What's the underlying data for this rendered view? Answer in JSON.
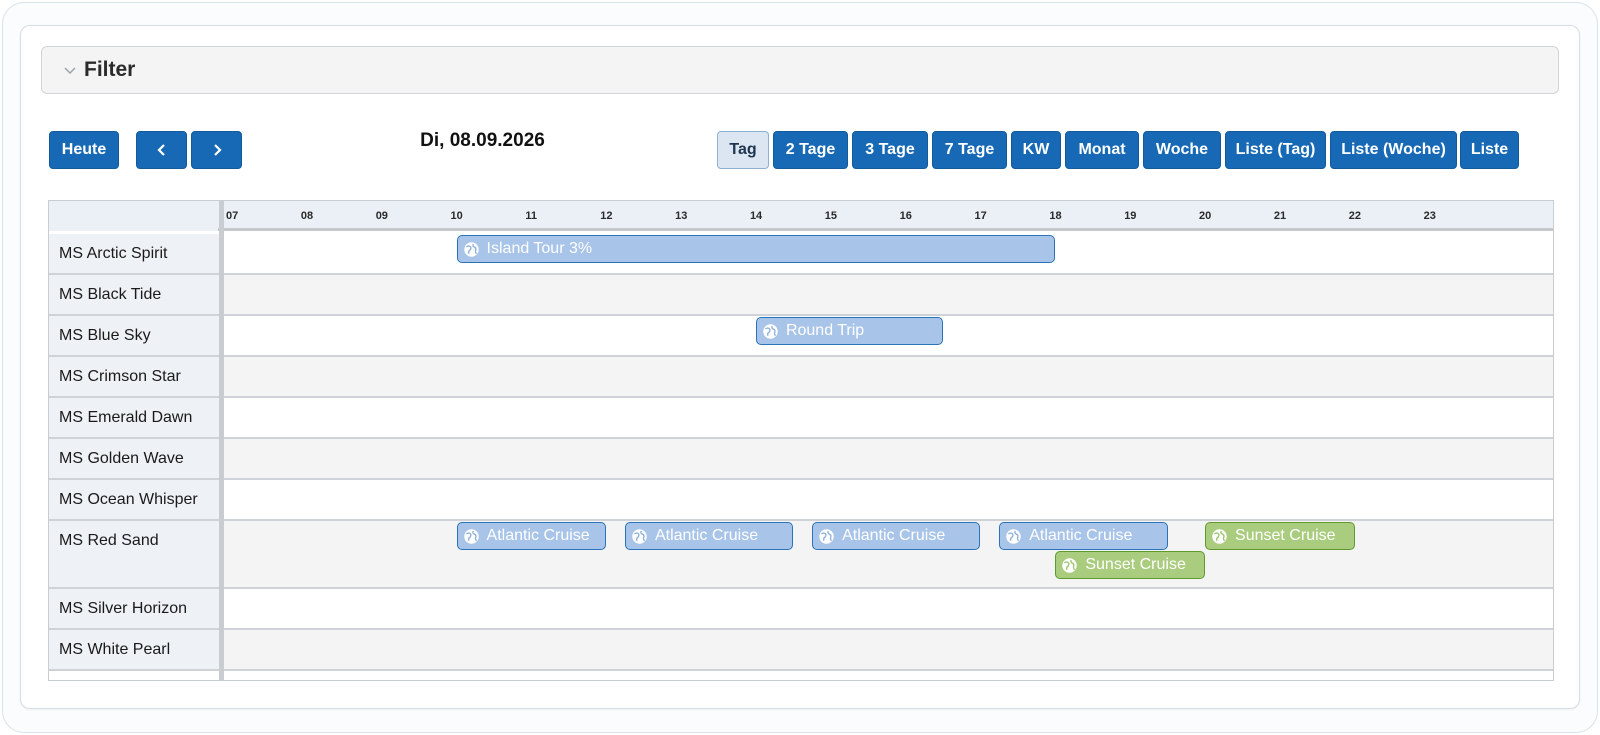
{
  "filter": {
    "label": "Filter"
  },
  "toolbar": {
    "today_label": "Heute",
    "date_title": "Di, 08.09.2026",
    "views": [
      "Tag",
      "2 Tage",
      "3 Tage",
      "7 Tage",
      "KW",
      "Monat",
      "Woche",
      "Liste (Tag)",
      "Liste (Woche)",
      "Liste"
    ],
    "active_view": "Tag"
  },
  "timeline": {
    "hours": [
      "07",
      "08",
      "09",
      "10",
      "11",
      "12",
      "13",
      "14",
      "15",
      "16",
      "17",
      "18",
      "19",
      "20",
      "21",
      "22",
      "23"
    ]
  },
  "resources": [
    {
      "name": "MS Arctic Spirit",
      "events": [
        {
          "title": "Island Tour 3%",
          "color": "blue",
          "start": "10:00",
          "end": "18:00"
        }
      ]
    },
    {
      "name": "MS Black Tide",
      "events": []
    },
    {
      "name": "MS Blue Sky",
      "events": [
        {
          "title": "Round Trip",
          "color": "blue",
          "start": "14:00",
          "end": "16:30"
        }
      ]
    },
    {
      "name": "MS Crimson Star",
      "events": []
    },
    {
      "name": "MS Emerald Dawn",
      "events": []
    },
    {
      "name": "MS Golden Wave",
      "events": []
    },
    {
      "name": "MS Ocean Whisper",
      "events": []
    },
    {
      "name": "MS Red Sand",
      "events": [
        {
          "title": "Atlantic Cruise",
          "color": "blue",
          "start": "10:00",
          "end": "12:00"
        },
        {
          "title": "Atlantic Cruise",
          "color": "blue",
          "start": "12:15",
          "end": "14:30"
        },
        {
          "title": "Atlantic Cruise",
          "color": "blue",
          "start": "14:45",
          "end": "17:00"
        },
        {
          "title": "Atlantic Cruise",
          "color": "blue",
          "start": "17:15",
          "end": "19:30"
        },
        {
          "title": "Sunset Cruise",
          "color": "green",
          "start": "18:00",
          "end": "20:00"
        },
        {
          "title": "Sunset Cruise",
          "color": "green",
          "start": "20:00",
          "end": "22:00"
        }
      ]
    },
    {
      "name": "MS Silver Horizon",
      "events": []
    },
    {
      "name": "MS White Pearl",
      "events": []
    }
  ],
  "colors": {
    "primary": "#1769b5",
    "event_blue": "#a8c4e8",
    "event_green": "#a9cc7e"
  },
  "icons": {
    "prev": "chevron-left-icon",
    "next": "chevron-right-icon",
    "event": "globe-icon",
    "filter": "chevron-down-icon"
  }
}
